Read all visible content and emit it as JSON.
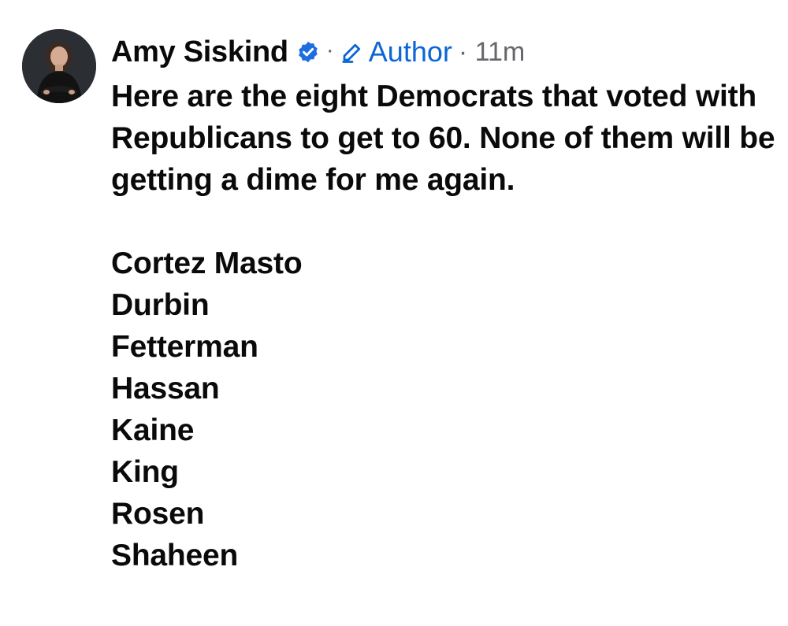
{
  "post": {
    "author": "Amy Siskind",
    "verified_icon": "verified-badge-icon",
    "separator": "·",
    "author_badge": "Author",
    "badge_icon": "pen-icon",
    "time_separator": "· 11m",
    "paragraph": "Here are the eight Democrats that voted with Republicans to get to 60. None of them will be getting a dime for me again.",
    "names": [
      "Cortez Masto",
      "Durbin",
      "Fetterman",
      "Hassan",
      "Kaine",
      "King",
      "Rosen",
      "Shaheen"
    ],
    "colors": {
      "text": "#0a0a0a",
      "muted": "#65676b",
      "accent": "#0a66d6",
      "verified": "#1d6fe0"
    }
  }
}
